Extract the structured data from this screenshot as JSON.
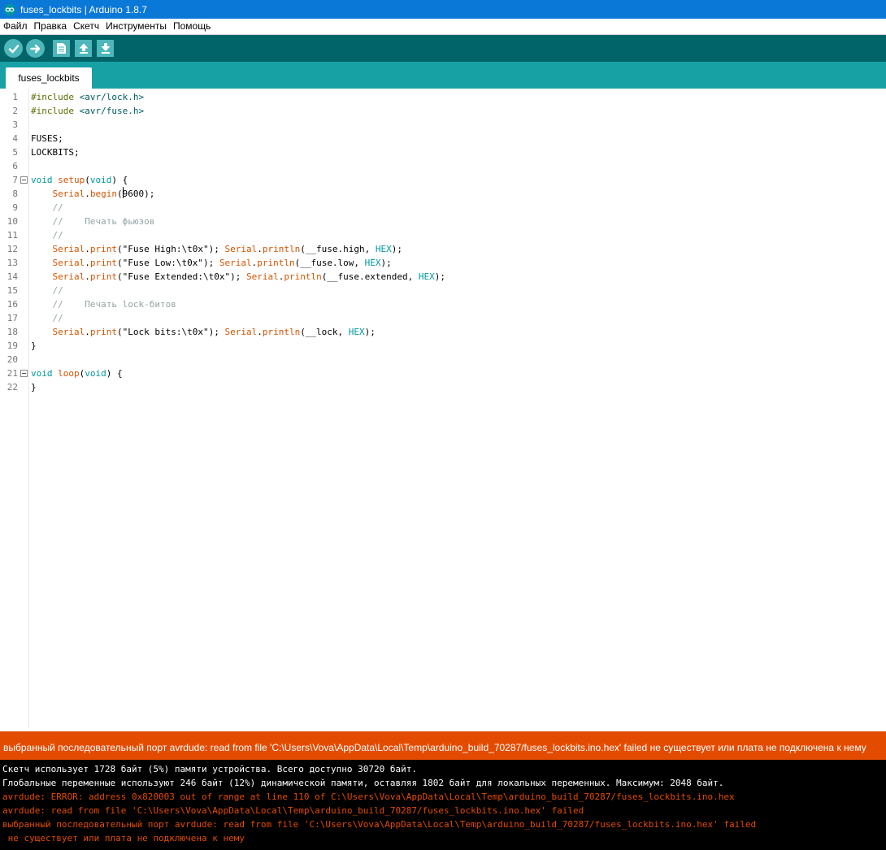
{
  "window": {
    "title": "fuses_lockbits | Arduino 1.8.7"
  },
  "menu": [
    "Файл",
    "Правка",
    "Скетч",
    "Инструменты",
    "Помощь"
  ],
  "toolbar": {
    "buttons": [
      "check-icon",
      "arrow-right-icon",
      "new-file-icon",
      "arrow-up-icon",
      "arrow-down-icon"
    ]
  },
  "tabs": {
    "active": "fuses_lockbits"
  },
  "editor": {
    "line_numbers": [
      "1",
      "2",
      "3",
      "4",
      "5",
      "6",
      "7",
      "8",
      "9",
      "10",
      "11",
      "12",
      "13",
      "14",
      "15",
      "16",
      "17",
      "18",
      "19",
      "20",
      "21",
      "22"
    ],
    "code": {
      "l1": {
        "directive": "#include",
        "header": " <avr/lock.h>"
      },
      "l2": {
        "directive": "#include",
        "header": " <avr/fuse.h>"
      },
      "l4": {
        "text": "FUSES;"
      },
      "l5": {
        "text": "LOCKBITS;"
      },
      "l7": {
        "kw1": "void",
        "fn": "setup",
        "p1": "(",
        "kw2": "void",
        "p2": ") {"
      },
      "l8": {
        "obj": "Serial",
        "dot": ".",
        "fn": "begin",
        "open": "(",
        "arg": "9600",
        "close": ");"
      },
      "l9": {
        "comment": "//"
      },
      "l10": {
        "comment": "//    Печать фьюзов"
      },
      "l11": {
        "comment": "//"
      },
      "l12": {
        "obj": "Serial",
        "dot": ".",
        "fn": "print",
        "str": "(\"Fuse High:\\t0x\"); ",
        "obj2": "Serial",
        "dot2": ".",
        "fn2": "println",
        "args": "(__fuse.high, ",
        "const": "HEX",
        "end": ");"
      },
      "l13": {
        "obj": "Serial",
        "dot": ".",
        "fn": "print",
        "str": "(\"Fuse Low:\\t0x\"); ",
        "obj2": "Serial",
        "dot2": ".",
        "fn2": "println",
        "args": "(__fuse.low, ",
        "const": "HEX",
        "end": ");"
      },
      "l14": {
        "obj": "Serial",
        "dot": ".",
        "fn": "print",
        "str": "(\"Fuse Extended:\\t0x\"); ",
        "obj2": "Serial",
        "dot2": ".",
        "fn2": "println",
        "args": "(__fuse.extended, ",
        "const": "HEX",
        "end": ");"
      },
      "l15": {
        "comment": "//"
      },
      "l16": {
        "comment": "//    Печать lock-битов"
      },
      "l17": {
        "comment": "//"
      },
      "l18": {
        "obj": "Serial",
        "dot": ".",
        "fn": "print",
        "str": "(\"Lock bits:\\t0x\"); ",
        "obj2": "Serial",
        "dot2": ".",
        "fn2": "println",
        "args": "(__lock, ",
        "const": "HEX",
        "end": ");"
      },
      "l19": {
        "text": "}"
      },
      "l21": {
        "kw1": "void",
        "fn": "loop",
        "p1": "(",
        "kw2": "void",
        "p2": ") {"
      },
      "l22": {
        "text": "}"
      }
    }
  },
  "status": {
    "message": "выбранный последовательный порт avrdude: read from file 'C:\\Users\\Vova\\AppData\\Local\\Temp\\arduino_build_70287/fuses_lockbits.ino.hex' failed не существует или плата не подключена к нему"
  },
  "console": {
    "lines": [
      "Скетч использует 1728 байт (5%) памяти устройства. Всего доступно 30720 байт.",
      "Глобальные переменные используют 246 байт (12%) динамической памяти, оставляя 1802 байт для локальных переменных. Максимум: 2048 байт.",
      "avrdude: ERROR: address 0x820003 out of range at line 110 of C:\\Users\\Vova\\AppData\\Local\\Temp\\arduino_build_70287/fuses_lockbits.ino.hex",
      "avrdude: read from file 'C:\\Users\\Vova\\AppData\\Local\\Temp\\arduino_build_70287/fuses_lockbits.ino.hex' failed",
      "выбранный последовательный порт avrdude: read from file 'C:\\Users\\Vova\\AppData\\Local\\Temp\\arduino_build_70287/fuses_lockbits.ino.hex' failed",
      " не существует или плата не подключена к нему"
    ]
  },
  "colors": {
    "titlebar": "#0a78d7",
    "toolbar": "#006468",
    "tabbar": "#17a1a5",
    "button": "#4db7bb",
    "keyword": "#00979c",
    "function": "#d35400",
    "comment": "#95a5a6",
    "error": "#e34c00"
  }
}
